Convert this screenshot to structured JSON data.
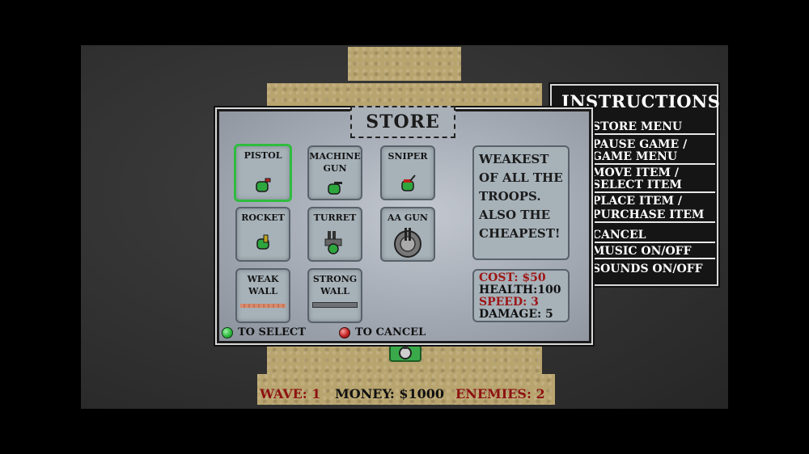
{
  "store": {
    "title": "STORE",
    "items": [
      {
        "label": "PISTOL",
        "selected": true
      },
      {
        "label": "MACHINE GUN",
        "line1": "MACHINE",
        "line2": "GUN"
      },
      {
        "label": "SNIPER"
      },
      {
        "label": "ROCKET"
      },
      {
        "label": "TURRET"
      },
      {
        "label": "AA GUN"
      },
      {
        "label": "WEAK WALL",
        "line1": "WEAK",
        "line2": "WALL"
      },
      {
        "label": "STRONG WALL",
        "line1": "STRONG",
        "line2": "WALL"
      }
    ],
    "description": [
      "WEAKEST",
      "OF ALL THE",
      "TROOPS.",
      "ALSO THE",
      "CHEAPEST!"
    ],
    "stats": {
      "cost": "COST: $50",
      "health": "HEALTH:100",
      "speed": "SPEED: 3",
      "damage": "DAMAGE: 5"
    },
    "select_hint": "TO SELECT",
    "cancel_hint": "TO CANCEL"
  },
  "instructions": {
    "title": "INSTRUCTIONS",
    "items": [
      "STORE MENU",
      "PAUSE GAME /",
      "GAME MENU",
      "MOVE ITEM /",
      "SELECT ITEM",
      "PLACE ITEM /",
      "PURCHASE ITEM",
      "CANCEL",
      "MUSIC ON/OFF",
      "SOUNDS ON/OFF"
    ]
  },
  "hud": {
    "wave": "WAVE: 1",
    "money": "MONEY: $1000",
    "enemies": "ENEMIES: 2"
  },
  "colors": {
    "select_button": "#2ebc3f",
    "cancel_button": "#c42020",
    "accent_red": "#8e1212",
    "sand": "#b8a46e"
  }
}
